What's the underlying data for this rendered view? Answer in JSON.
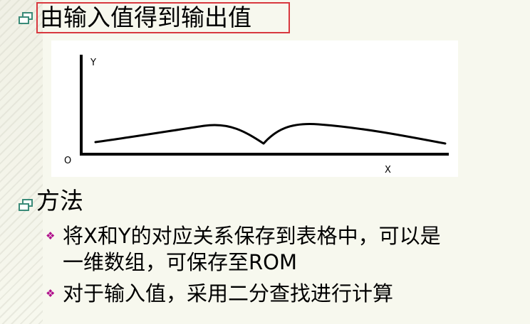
{
  "title": "由输入值得到输出值",
  "figure": {
    "y_label": "Y",
    "origin_label": "O",
    "x_label": "X"
  },
  "section_heading": "方法",
  "bullets": [
    {
      "lines": [
        "将X和Y的对应关系保存到表格中，可以是",
        "一维数组，可保存至ROM"
      ]
    },
    {
      "lines": [
        "对于输入值，采用二分查找进行计算"
      ]
    }
  ],
  "colors": {
    "highlight_border": "#d8383e",
    "bullet_icon": "#3a8a78",
    "sub_bullet": "#b0108c",
    "background": "#f7f8ee"
  },
  "icons": {
    "heading_bullet": "window-bullet-icon",
    "sub_bullet": "diamond-bullet-icon"
  }
}
